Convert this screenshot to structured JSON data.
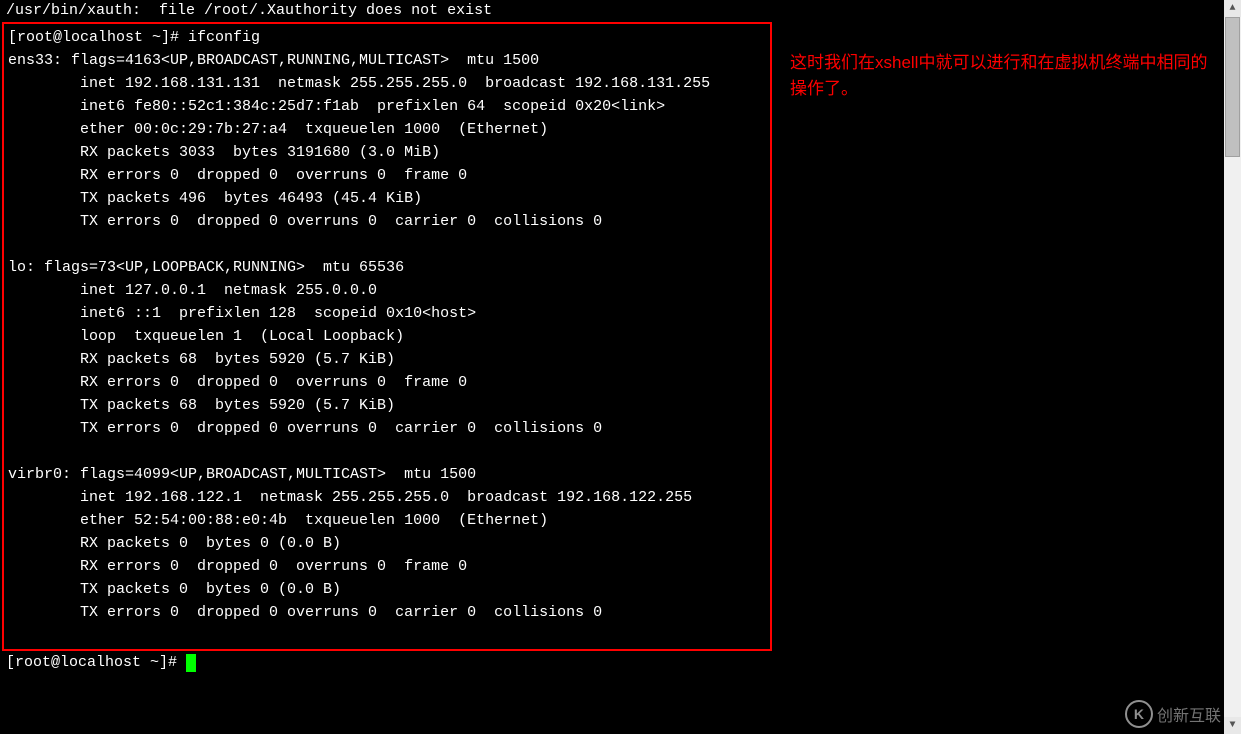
{
  "header_line": "/usr/bin/xauth:  file /root/.Xauthority does not exist",
  "terminal_lines": [
    "[root@localhost ~]# ifconfig",
    "ens33: flags=4163<UP,BROADCAST,RUNNING,MULTICAST>  mtu 1500",
    "        inet 192.168.131.131  netmask 255.255.255.0  broadcast 192.168.131.255",
    "        inet6 fe80::52c1:384c:25d7:f1ab  prefixlen 64  scopeid 0x20<link>",
    "        ether 00:0c:29:7b:27:a4  txqueuelen 1000  (Ethernet)",
    "        RX packets 3033  bytes 3191680 (3.0 MiB)",
    "        RX errors 0  dropped 0  overruns 0  frame 0",
    "        TX packets 496  bytes 46493 (45.4 KiB)",
    "        TX errors 0  dropped 0 overruns 0  carrier 0  collisions 0",
    "",
    "lo: flags=73<UP,LOOPBACK,RUNNING>  mtu 65536",
    "        inet 127.0.0.1  netmask 255.0.0.0",
    "        inet6 ::1  prefixlen 128  scopeid 0x10<host>",
    "        loop  txqueuelen 1  (Local Loopback)",
    "        RX packets 68  bytes 5920 (5.7 KiB)",
    "        RX errors 0  dropped 0  overruns 0  frame 0",
    "        TX packets 68  bytes 5920 (5.7 KiB)",
    "        TX errors 0  dropped 0 overruns 0  carrier 0  collisions 0",
    "",
    "virbr0: flags=4099<UP,BROADCAST,MULTICAST>  mtu 1500",
    "        inet 192.168.122.1  netmask 255.255.255.0  broadcast 192.168.122.255",
    "        ether 52:54:00:88:e0:4b  txqueuelen 1000  (Ethernet)",
    "        RX packets 0  bytes 0 (0.0 B)",
    "        RX errors 0  dropped 0  overruns 0  frame 0",
    "        TX packets 0  bytes 0 (0.0 B)",
    "        TX errors 0  dropped 0 overruns 0  carrier 0  collisions 0",
    ""
  ],
  "bottom_prompt": "[root@localhost ~]# ",
  "annotation": {
    "prefix": "这时我们在",
    "highlighted": "xshell",
    "suffix": "中就可以进行和在虚拟机终端中相同的操作了。"
  },
  "watermark": {
    "icon_letter": "K",
    "text": "创新互联"
  },
  "scrollbar": {
    "arrow_up": "▲",
    "arrow_down": "▼"
  }
}
